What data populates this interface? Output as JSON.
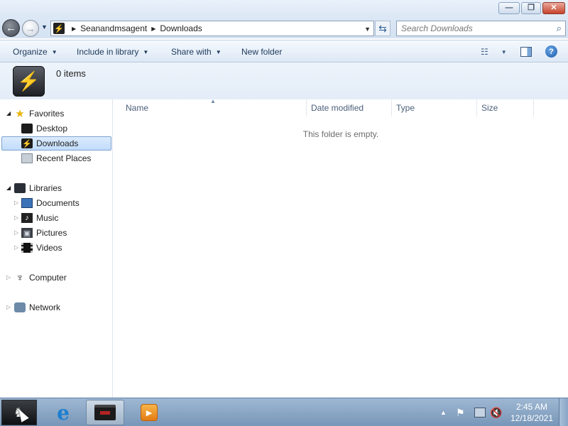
{
  "window": {
    "minimize_glyph": "—",
    "maximize_glyph": "❐",
    "close_glyph": "✕"
  },
  "navigation": {
    "back_glyph": "←",
    "forward_glyph": "→",
    "address_segments": [
      "Seanandmsagent",
      "Downloads"
    ],
    "search_placeholder": "Search Downloads"
  },
  "command_bar": {
    "organize": "Organize",
    "include_in_library": "Include in library",
    "share_with": "Share with",
    "new_folder": "New folder",
    "help_glyph": "?"
  },
  "details": {
    "item_count": "0 items"
  },
  "nav_pane": {
    "favorites": {
      "label": "Favorites",
      "items": [
        "Desktop",
        "Downloads",
        "Recent Places"
      ],
      "selected": "Downloads"
    },
    "libraries": {
      "label": "Libraries",
      "items": [
        "Documents",
        "Music",
        "Pictures",
        "Videos"
      ]
    },
    "computer": "Computer",
    "network": "Network"
  },
  "content": {
    "columns": [
      "Name",
      "Date modified",
      "Type",
      "Size"
    ],
    "sort_column": "Name",
    "empty_message": "This folder is empty."
  },
  "taskbar": {
    "apps": [
      "start-button",
      "internet-explorer",
      "windows-explorer",
      "windows-media-player"
    ],
    "active_app": "windows-explorer",
    "clock_time": "2:45 AM",
    "clock_date": "12/18/2021"
  },
  "colors": {
    "title_bar": "#dbe7f5",
    "selection_fill": "#c1dcfc",
    "selection_border": "#7da2ce",
    "close_button": "#c7432d",
    "taskbar": "#8ba7c6",
    "header_text": "#4c607a"
  }
}
